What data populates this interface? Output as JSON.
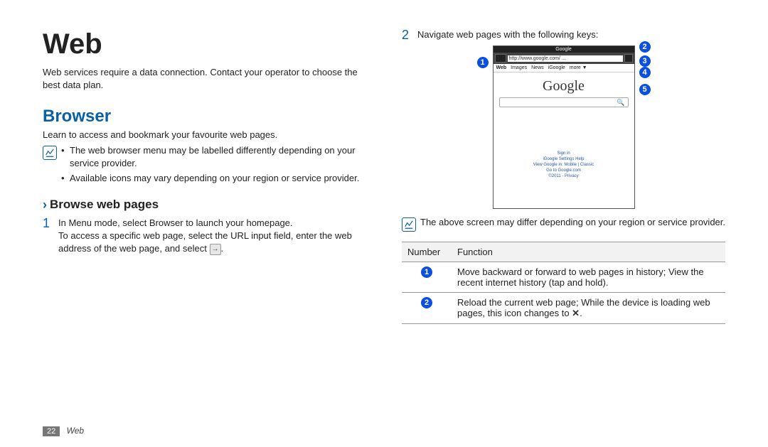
{
  "title": "Web",
  "intro": "Web services require a data connection. Contact your operator to choose the best data plan.",
  "section_heading": "Browser",
  "section_intro": "Learn to access and bookmark your favourite web pages.",
  "notes_left": [
    "The web browser menu may be labelled differently depending on your service provider.",
    "Available icons may vary depending on your region or service provider."
  ],
  "subsection_title": "Browse web pages",
  "steps": [
    {
      "num": "1",
      "body_line1": "In Menu mode, select Browser to launch your homepage.",
      "body_line2": "To access a specific web page, select the URL input field, enter the web address of the web page, and select",
      "body_after_icon": "."
    },
    {
      "num": "2",
      "body_line1": "Navigate web pages with the following keys:"
    }
  ],
  "phone": {
    "status": "Google",
    "url": "http://www.google.com/ ...",
    "tabs": [
      "Web",
      "Images",
      "News",
      "iGoogle",
      "more ▼"
    ],
    "logo": "Google",
    "footer_lines": [
      "Sign in",
      "iGoogle   Settings   Help",
      "View Google in: Mobile | Classic",
      "Go to Google.com",
      "©2011 - Privacy"
    ]
  },
  "callouts": [
    "1",
    "2",
    "3",
    "4",
    "5"
  ],
  "note_right": "The above screen may differ depending on your region or service provider.",
  "table": {
    "headers": [
      "Number",
      "Function"
    ],
    "rows": [
      {
        "num": "1",
        "func": "Move backward or forward to web pages in history; View the recent internet history (tap and hold)."
      },
      {
        "num": "2",
        "func_pre": "Reload the current web page; While the device is loading web pages, this icon changes to ",
        "func_post": "."
      }
    ]
  },
  "footer": {
    "page": "22",
    "chapter": "Web"
  }
}
